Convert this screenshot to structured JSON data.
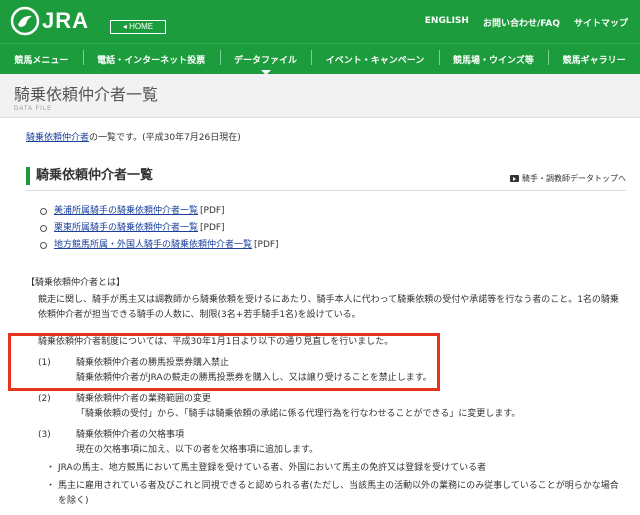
{
  "header": {
    "logo_text": "JRA",
    "home_button": "◂ HOME",
    "top_links": [
      "ENGLISH",
      "お問い合わせ/FAQ",
      "サイトマップ"
    ]
  },
  "nav": {
    "items": [
      "競馬メニュー",
      "電話・インターネット投票",
      "データファイル",
      "イベント・キャンペーン",
      "競馬場・ウインズ等",
      "競馬ギャラリー"
    ],
    "active_index": 2
  },
  "title_strip": {
    "title": "騎乗依頼仲介者一覧",
    "subtitle": "DATA FILE"
  },
  "intro": {
    "link": "騎乗依頼仲介者",
    "text": "の一覧です。(平成30年7月26日現在)"
  },
  "section": {
    "title": "騎乗依頼仲介者一覧",
    "top_link": "騎手・調教師データトップへ"
  },
  "pdf_links": [
    {
      "label": "美浦所属騎手の騎乗依頼仲介者一覧",
      "tag": "[PDF]"
    },
    {
      "label": "栗東所属騎手の騎乗依頼仲介者一覧",
      "tag": "[PDF]"
    },
    {
      "label": "地方競馬所属・外国人騎手の騎乗依頼仲介者一覧",
      "tag": "[PDF]"
    }
  ],
  "definition": {
    "title": "【騎乗依頼仲介者とは】",
    "body": "競走に関し、騎手が馬主又は調教師から騎乗依頼を受けるにあたり、騎手本人に代わって騎乗依頼の受付や承諾等を行なう者のこと。1名の騎乗依頼仲介者が担当できる騎手の人数に、制限(3名+若手騎手1名)を設けている。"
  },
  "revision": {
    "intro": "騎乗依頼仲介者制度については、平成30年1月1日より以下の通り見直しを行いました。",
    "items": [
      {
        "num": "(1)",
        "title": "騎乗依頼仲介者の勝馬投票券購入禁止",
        "body": "騎乗依頼仲介者がJRAの競走の勝馬投票券を購入し、又は譲り受けることを禁止します。"
      },
      {
        "num": "(2)",
        "title": "騎乗依頼仲介者の業務範囲の変更",
        "body": "「騎乗依頼の受付」から、「騎手は騎乗依頼の承諾に係る代理行為を行なわせることができる」に変更します。"
      },
      {
        "num": "(3)",
        "title": "騎乗依頼仲介者の欠格事項",
        "body": "現在の欠格事項に加え、以下の者を欠格事項に追加します。"
      }
    ],
    "bullets": [
      "JRAの馬主、地方競馬において馬主登録を受けている者、外国において馬主の免許又は登録を受けている者",
      "馬主に雇用されている者及びこれと同視できると認められる者(ただし、当該馬主の活動以外の業務にのみ従事していることが明らかな場合を除く)"
    ],
    "bullet_mark": "・"
  },
  "colors": {
    "brand_green": "#1c9c3c",
    "highlight_red": "#e8321b",
    "link_blue": "#1a3f9c"
  }
}
